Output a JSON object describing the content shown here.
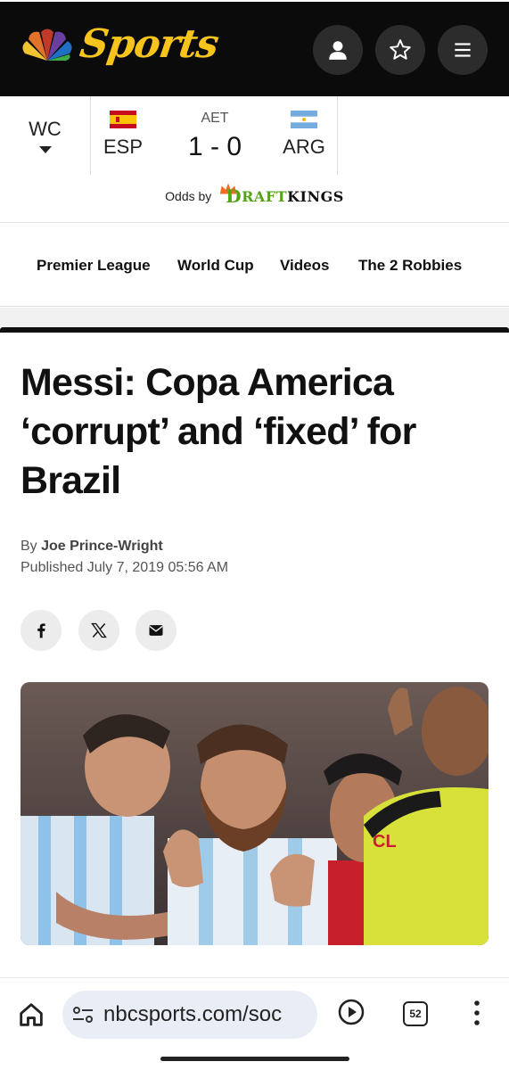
{
  "header": {
    "brand": "Sports",
    "buttons": [
      {
        "name": "account",
        "icon": "user-icon"
      },
      {
        "name": "favorites",
        "icon": "star-icon"
      },
      {
        "name": "menu",
        "icon": "hamburger-icon"
      }
    ],
    "brand_color": "#f6c41c",
    "background": "#0b0b0b"
  },
  "scores": {
    "league": "WC",
    "game": {
      "status": "AET",
      "home": {
        "abbr": "ESP",
        "flag": "spain-flag-icon"
      },
      "away": {
        "abbr": "ARG",
        "flag": "argentina-flag-icon"
      },
      "score": "1 - 0"
    },
    "odds_label": "Odds by",
    "odds_brand": "DRAFTKINGS",
    "odds_brand_first": "D",
    "odds_brand_mid": "RAFT",
    "odds_brand_end": "KINGS"
  },
  "nav": {
    "items": [
      "Premier League",
      "World Cup",
      "Videos",
      "The 2 Robbies"
    ]
  },
  "article": {
    "headline": "Messi: Copa America ‘corrupt’ and ‘fixed’ for Brazil",
    "by": "By",
    "author": "Joe Prince-Wright",
    "published": "Published July 7, 2019 05:56 AM",
    "share": [
      {
        "name": "facebook",
        "icon": "facebook-icon"
      },
      {
        "name": "x",
        "icon": "x-icon"
      },
      {
        "name": "email",
        "icon": "mail-icon"
      }
    ]
  },
  "browser": {
    "url": "nbcsports.com/soc",
    "tab_count": "52"
  }
}
